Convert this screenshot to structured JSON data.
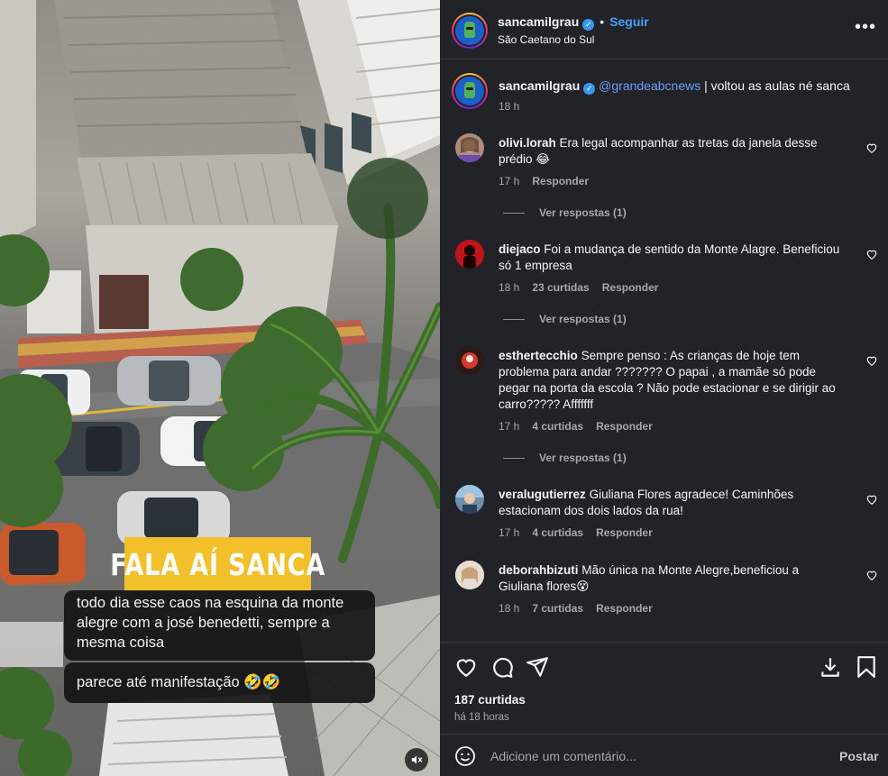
{
  "post": {
    "username": "sancamilgrau",
    "follow_label": "Seguir",
    "location": "São Caetano do Sul",
    "caption_username": "sancamilgrau",
    "caption_mention": "@grandeabcnews",
    "caption_text": " | voltou as aulas né sanca",
    "caption_time": "18 h"
  },
  "media": {
    "banner": "FALA AÍ SANCA",
    "bubble1": "todo dia esse caos na esquina da monte alegre com a josé benedetti, sempre a mesma coisa",
    "bubble2": "parece até manifestação 🤣🤣"
  },
  "comments": [
    {
      "username": "olivi.lorah",
      "text": "Era legal acompanhar as tretas da janela desse prédio 😂",
      "time": "17 h",
      "likes": "",
      "reply": "Responder",
      "replies": "Ver respostas (1)",
      "avatar_color": "#b08a7a"
    },
    {
      "username": "diejaco",
      "text": "Foi a mudança de sentido da Monte Alagre. Beneficiou só 1 empresa",
      "time": "18 h",
      "likes": "23 curtidas",
      "reply": "Responder",
      "replies": "Ver respostas (1)",
      "avatar_color": "#c0141c"
    },
    {
      "username": "esthertecchio",
      "text": "Sempre penso : As crianças de hoje tem problema para andar ??????? O papai , a mamãe só pode pegar na porta da escola ? Não pode estacionar e se dirigir ao carro????? Afffffff",
      "time": "17 h",
      "likes": "4 curtidas",
      "reply": "Responder",
      "replies": "Ver respostas (1)",
      "avatar_color": "#b8322a"
    },
    {
      "username": "veralugutierrez",
      "text": "Giuliana Flores agradece! Caminhões estacionam dos dois lados da rua!",
      "time": "17 h",
      "likes": "4 curtidas",
      "reply": "Responder",
      "replies": "",
      "avatar_color": "#6d8fb0"
    },
    {
      "username": "deborahbizuti",
      "text": "Mão única na Monte Alegre,beneficiou a Giuliana flores😵",
      "time": "18 h",
      "likes": "7 curtidas",
      "reply": "Responder",
      "replies": "",
      "avatar_color": "#d8c3b4"
    }
  ],
  "footer": {
    "likes": "187 curtidas",
    "time_ago": "há 18 horas",
    "comment_placeholder": "Adicione um comentário...",
    "post_label": "Postar"
  },
  "colors": {
    "panel_bg": "#212328",
    "link_blue": "#4a9ff5",
    "verified_blue": "#3897f0",
    "banner_yellow": "#f2c02a"
  }
}
